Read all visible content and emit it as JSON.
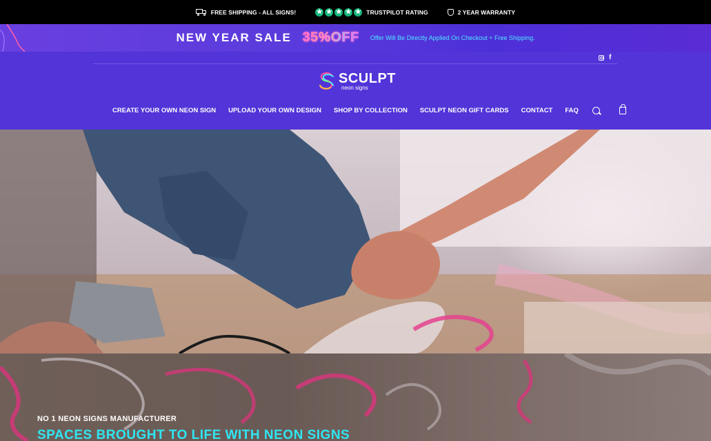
{
  "topbar": {
    "shipping": "FREE SHIPPING - ALL SIGNS!",
    "trustpilot": "TRUSTPILOT RATING",
    "warranty": "2 YEAR WARRANTY",
    "star_glyph": "★",
    "icons": [
      "truck-icon",
      "trustpilot-stars-icon",
      "shield-icon"
    ]
  },
  "sale": {
    "title": "NEW YEAR SALE",
    "percent": "35%OFF",
    "note": "Offer Will Be Directly Applied On Checkout + Free Shipping."
  },
  "header": {
    "social": {
      "facebook": "f"
    },
    "logo": {
      "name": "SCULPT",
      "sub": "neon signs"
    },
    "nav": [
      {
        "label": "CREATE YOUR OWN NEON SIGN"
      },
      {
        "label": "UPLOAD YOUR OWN DESIGN"
      },
      {
        "label": "SHOP BY COLLECTION"
      },
      {
        "label": "SCULPT NEON GIFT CARDS"
      },
      {
        "label": "CONTACT"
      },
      {
        "label": "FAQ"
      }
    ],
    "icons": [
      "instagram-icon",
      "facebook-icon",
      "search-icon",
      "cart-icon"
    ]
  },
  "hero": {
    "eyebrow": "NO 1 NEON SIGNS MANUFACTURER",
    "headline": "SPACES BROUGHT TO LIFE WITH NEON SIGNS"
  },
  "colors": {
    "topbar_bg": "#000000",
    "header_bg": "#5234d8",
    "sale_accent": "#4ee8ff",
    "headline": "#2fe6f2",
    "trustpilot_green": "#11b67a"
  }
}
